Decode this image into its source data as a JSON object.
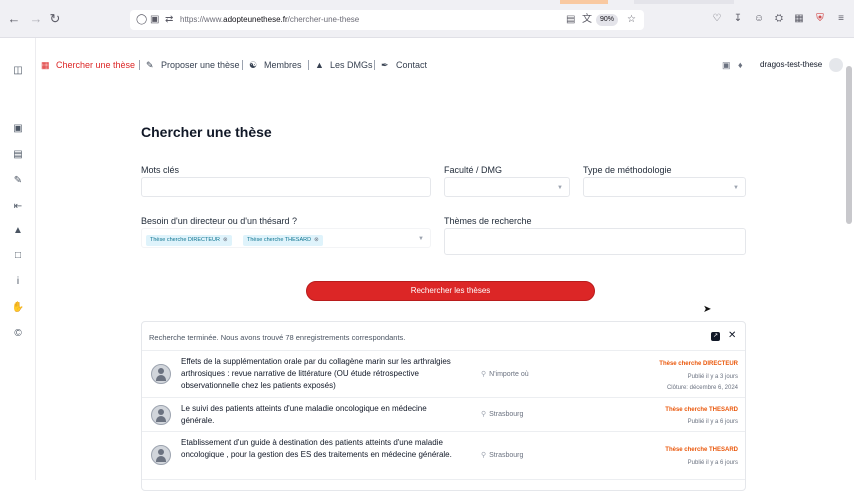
{
  "browser": {
    "url_scheme": "https://www.",
    "url_host": "adopteunethese.fr",
    "url_path": "/chercher-une-these",
    "zoom": "90%"
  },
  "nav": {
    "items": [
      {
        "label": "Chercher une thèse",
        "icon": "library-icon"
      },
      {
        "label": "Proposer une thèse",
        "icon": "pencil-icon"
      },
      {
        "label": "Membres",
        "icon": "users-icon"
      },
      {
        "label": "Les DMGs",
        "icon": "graduation-cap-icon"
      },
      {
        "label": "Contact",
        "icon": "feather-icon"
      }
    ],
    "user": "dragos-test-these"
  },
  "page": {
    "title": "Chercher une thèse",
    "keywords_label": "Mots clés",
    "faculty_label": "Faculté / DMG",
    "method_label": "Type de méthodologie",
    "need_label": "Besoin d'un directeur ou d'un thésard ?",
    "themes_label": "Thèmes de recherche",
    "tags": [
      "Thèse cherche DIRECTEUR",
      "Thèse cherche THESARD"
    ],
    "search_button": "Rechercher les thèses"
  },
  "results": {
    "status": "Recherche terminée. Nous avons trouvé 78 enregistrements correspondants.",
    "rows": [
      {
        "title": "Effets de la supplémentation orale par du collagène marin sur les arthralgies arthrosiques : revue narrative de littérature (OU étude rétrospective observationnelle chez les patients exposés)",
        "location": "N'importe où",
        "badge": "Thèse cherche DIRECTEUR",
        "published": "Publié il y a 3 jours",
        "closing": "Clôture: décembre 6, 2024"
      },
      {
        "title": "Le suivi des patients atteints d'une maladie oncologique en médecine générale.",
        "location": "Strasbourg",
        "badge": "Thèse cherche THESARD",
        "published": "Publié il y a 6 jours",
        "closing": ""
      },
      {
        "title": "Etablissement d'un guide à destination des patients atteints d'une maladie oncologique , pour la gestion des ES des traitements en médecine générale.",
        "location": "Strasbourg",
        "badge": "Thèse cherche THESARD",
        "published": "Publié il y a 6 jours",
        "closing": ""
      }
    ]
  }
}
